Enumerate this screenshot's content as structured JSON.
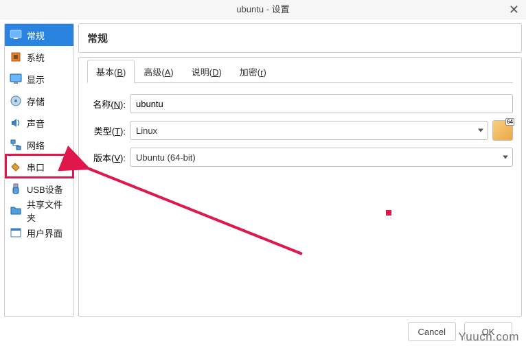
{
  "window": {
    "title": "ubuntu - 设置",
    "close_glyph": "✕"
  },
  "sidebar": {
    "items": [
      {
        "label": "常规"
      },
      {
        "label": "系统"
      },
      {
        "label": "显示"
      },
      {
        "label": "存储"
      },
      {
        "label": "声音"
      },
      {
        "label": "网络"
      },
      {
        "label": "串口"
      },
      {
        "label": "USB设备"
      },
      {
        "label": "共享文件夹"
      },
      {
        "label": "用户界面"
      }
    ],
    "active_index": 0,
    "highlighted_index": 5
  },
  "header": {
    "title": "常规"
  },
  "tabs": {
    "items": [
      {
        "label_prefix": "基本(",
        "hotkey": "B",
        "label_suffix": ")"
      },
      {
        "label_prefix": "高级(",
        "hotkey": "A",
        "label_suffix": ")"
      },
      {
        "label_prefix": "说明(",
        "hotkey": "D",
        "label_suffix": ")"
      },
      {
        "label_prefix": "加密(",
        "hotkey": "r",
        "label_suffix": ")"
      }
    ],
    "active_index": 0
  },
  "form": {
    "name": {
      "label_prefix": "名称(",
      "hotkey": "N",
      "label_suffix": "):",
      "value": "ubuntu"
    },
    "type": {
      "label_prefix": "类型(",
      "hotkey": "T",
      "label_suffix": "):",
      "value": "Linux"
    },
    "version": {
      "label_prefix": "版本(",
      "hotkey": "V",
      "label_suffix": "):",
      "value": "Ubuntu (64-bit)"
    }
  },
  "footer": {
    "cancel": "Cancel",
    "ok": "OK"
  },
  "watermark": "Yuucn.com",
  "icons": {
    "general": "monitor-icon",
    "system": "chip-icon",
    "display": "display-icon",
    "storage": "disk-icon",
    "audio": "speaker-icon",
    "network": "network-icon",
    "serial": "plug-icon",
    "usb": "usb-icon",
    "shared": "folder-icon",
    "ui": "window-icon"
  },
  "colors": {
    "accent": "#2b83e0",
    "annotation": "#e0174b"
  }
}
